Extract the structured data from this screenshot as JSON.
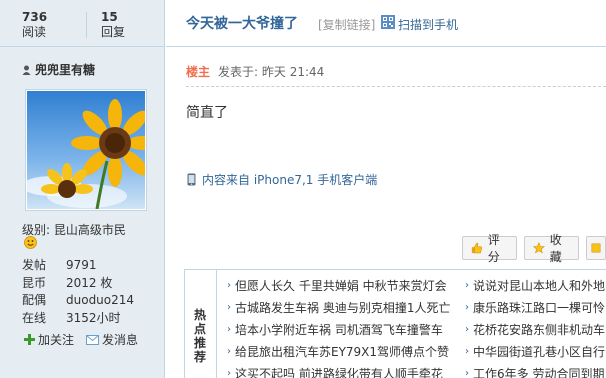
{
  "stats": {
    "views_num": "736",
    "views_label": "阅读",
    "replies_num": "15",
    "replies_label": "回复"
  },
  "author": {
    "name": "兜兜里有糖",
    "level_label": "级别:",
    "level_name": "昆山高级市民",
    "info": [
      {
        "k": "发帖",
        "v": "9791"
      },
      {
        "k": "昆币",
        "v": "2012 枚"
      },
      {
        "k": "配偶",
        "v": "duoduo214"
      },
      {
        "k": "在线",
        "v": "3152小时"
      }
    ],
    "follow_label": "加关注",
    "message_label": "发消息"
  },
  "post": {
    "title": "今天被一大爷撞了",
    "copy_link": "[复制链接]",
    "scan_label": "扫描到手机",
    "author_tag": "楼主",
    "posted": "发表于: 昨天 21:44",
    "content": "简直了",
    "client": "内容来自 iPhone7,1 手机客户端"
  },
  "buttons": {
    "rate": "评分",
    "favorite": "收藏"
  },
  "hot": {
    "label": "热点推荐",
    "left": [
      "但愿人长久 千里共婵娟 中秋节来赏灯会",
      "古城路发生车祸 奥迪与别克相撞1人死亡",
      "培本小学附近车祸 司机酒驾飞车撞警车",
      "给昆旅出租汽车苏EY79X1驾师傅点个赞",
      "这买不起吗 前进路绿化带有人顺手牵花"
    ],
    "right": [
      "说说对昆山本地人和外地",
      "康乐路珠江路口一棵可怜",
      "花桥花安路东侧非机动车",
      "中华园街道孔巷小区自行",
      "工作6年多 劳动合同到期"
    ]
  },
  "colors": {
    "accent": "#336699",
    "author_tag": "#f26c4f",
    "sidebar_bg": "#e5edf2",
    "border": "#c2d5e3"
  }
}
